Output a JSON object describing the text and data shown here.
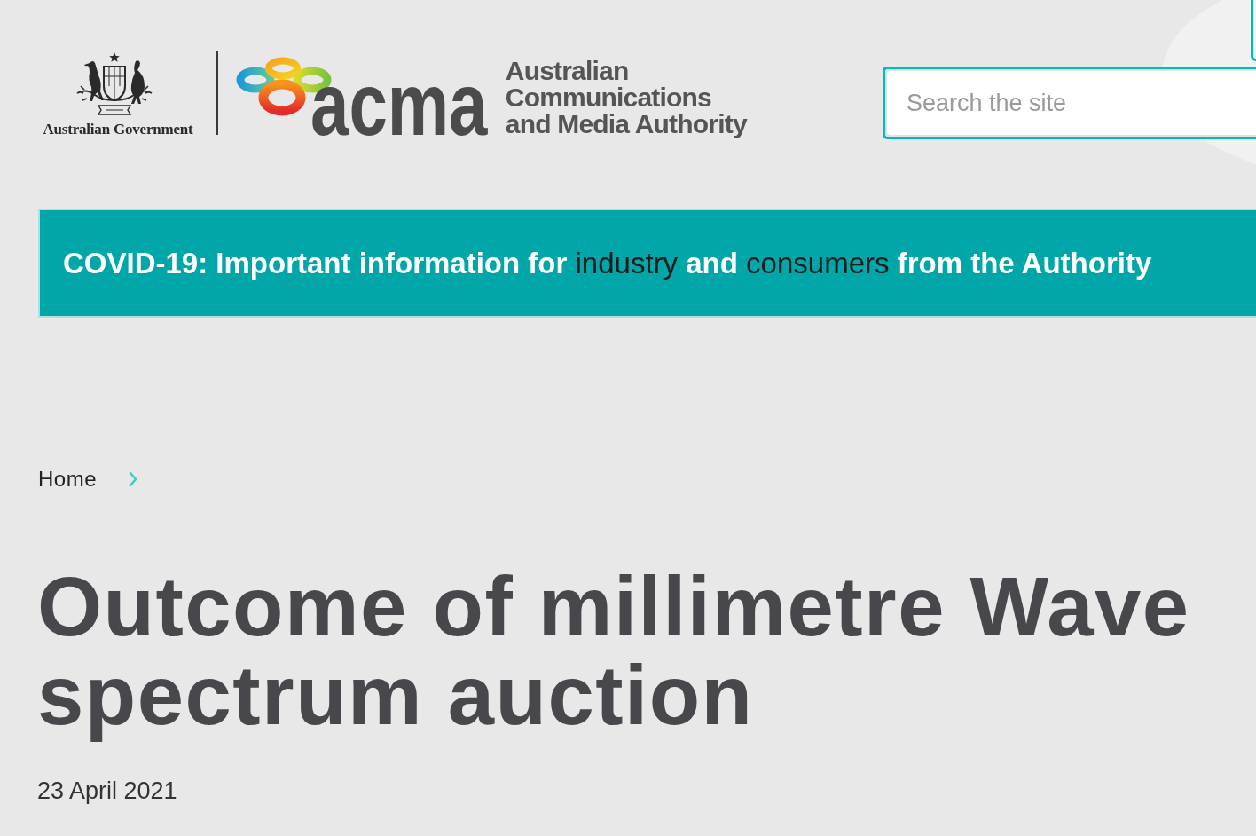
{
  "header": {
    "government_logo": {
      "text": "Australian Government"
    },
    "agency_logo": {
      "wordmark": "acma",
      "name_lines": [
        "Australian",
        "Communications",
        "and Media Authority"
      ]
    },
    "search": {
      "placeholder": "Search the site"
    }
  },
  "alert_banner": {
    "segments": [
      {
        "kind": "text",
        "text": "COVID-19: Important information for"
      },
      {
        "kind": "link",
        "text": "industry"
      },
      {
        "kind": "text",
        "text": "and"
      },
      {
        "kind": "link",
        "text": "consumers"
      },
      {
        "kind": "text",
        "text": "from the Authority"
      }
    ]
  },
  "breadcrumb": [
    {
      "label": "Home"
    }
  ],
  "article": {
    "title": "Outcome of millimetre Wave spectrum auction",
    "date": "23 April 2021"
  }
}
